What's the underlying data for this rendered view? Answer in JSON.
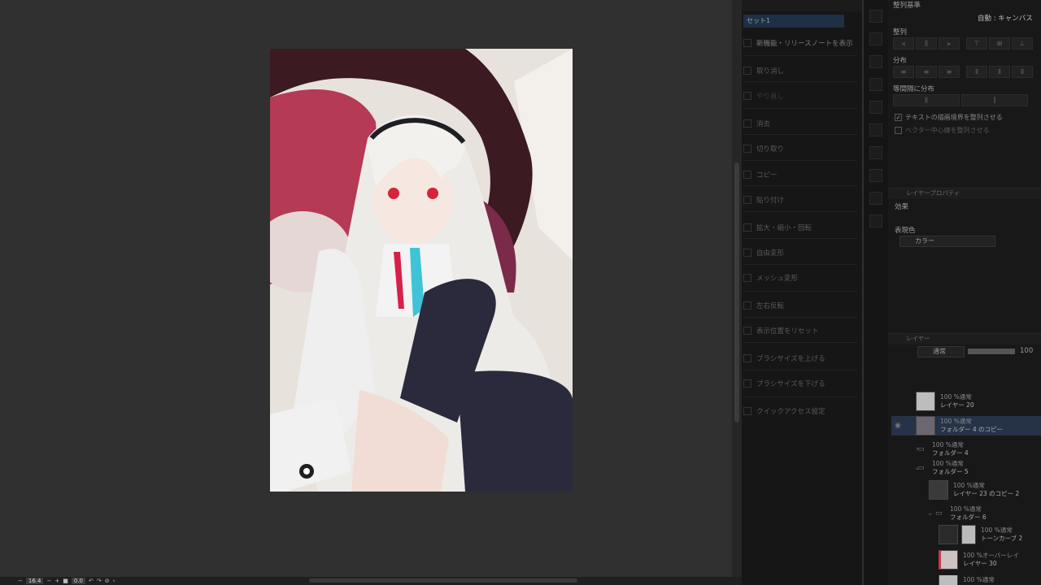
{
  "commands_panel": {
    "header": "セット1",
    "items": [
      {
        "label": "新機能・リリースノートを表示",
        "icon": "window-icon"
      },
      {
        "label": "取り消し",
        "icon": "undo-icon"
      },
      {
        "label": "やり直し",
        "icon": "redo-icon"
      },
      {
        "label": "消去",
        "icon": "clear-icon"
      },
      {
        "label": "切り取り",
        "icon": "scissors-icon"
      },
      {
        "label": "コピー",
        "icon": "copy-icon"
      },
      {
        "label": "貼り付け",
        "icon": "paste-icon"
      },
      {
        "label": "拡大・縮小・回転",
        "icon": "transform-icon"
      },
      {
        "label": "自由変形",
        "icon": "free-transform-icon"
      },
      {
        "label": "メッシュ変形",
        "icon": "mesh-icon"
      },
      {
        "label": "左右反転",
        "icon": "flip-icon"
      },
      {
        "label": "表示位置をリセット",
        "icon": "reset-view-icon"
      },
      {
        "label": "ブラシサイズを上げる",
        "icon": "brush-up-icon"
      },
      {
        "label": "ブラシサイズを下げる",
        "icon": "brush-down-icon"
      },
      {
        "label": "クイックアクセス設定",
        "icon": "settings-icon"
      }
    ]
  },
  "align_panel": {
    "title": "整列基準",
    "basis": "自動 : キャンバス",
    "align_label": "整列",
    "distribute_label": "分布",
    "equal_space_label": "等間隔に分布",
    "option1": "テキストの描画境界を整列させる",
    "option1_checked": "✓",
    "option2": "ベクター中心線を整列させる"
  },
  "layer_property": {
    "tab": "レイヤープロパティ",
    "effect_label": "効果",
    "color_label": "表現色",
    "color_value": "カラー"
  },
  "layer_panel": {
    "tab": "レイヤー",
    "blend_mode": "通常",
    "opacity": "100",
    "layers": [
      {
        "mode": "100 %通常",
        "name": "レイヤー 20"
      },
      {
        "mode": "100 %通常",
        "name": "フォルダー 4 のコピー"
      },
      {
        "mode": "100 %通常",
        "name": "フォルダー 4"
      },
      {
        "mode": "100 %通常",
        "name": "フォルダー 5"
      },
      {
        "mode": "100 %通常",
        "name": "レイヤー 23 のコピー 2"
      },
      {
        "mode": "100 %通常",
        "name": "フォルダー 6"
      },
      {
        "mode": "100 %通常",
        "name": "トーンカーブ 2"
      },
      {
        "mode": "100 %オーバーレイ",
        "name": "レイヤー 30"
      },
      {
        "mode": "100 %通常",
        "name": ""
      }
    ]
  },
  "status": {
    "zoom": "16.4",
    "angle": "0.0"
  }
}
